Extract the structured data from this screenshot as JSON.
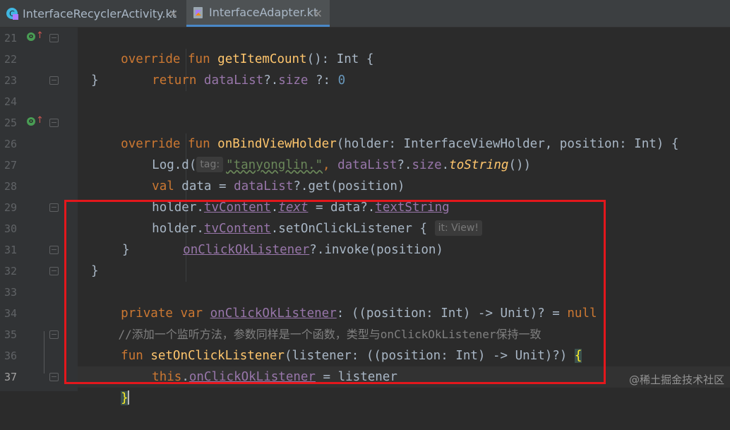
{
  "tabs": [
    {
      "label": "InterfaceRecyclerActivity.kt",
      "icon": "kotlin-class-icon",
      "active": false
    },
    {
      "label": "InterfaceAdapter.kt",
      "icon": "kotlin-file-icon",
      "active": true
    }
  ],
  "close_glyph": "✕",
  "override_marker": {
    "dot": "o",
    "arrow": "↑"
  },
  "line_numbers": [
    "21",
    "22",
    "23",
    "24",
    "25",
    "26",
    "27",
    "28",
    "29",
    "30",
    "31",
    "32",
    "33",
    "34",
    "35",
    "36",
    "37"
  ],
  "code": {
    "l21": {
      "override": "override",
      "fun": "fun",
      "name": "getItemCount",
      "rest": "(): Int {"
    },
    "l22": {
      "ret": "return",
      "dataList": "dataList",
      "qdot": "?.",
      "size": "size",
      "elvis": " ?: ",
      "zero": "0"
    },
    "l23": {
      "brace": "}"
    },
    "l25": {
      "override": "override",
      "fun": "fun",
      "name": "onBindViewHolder",
      "params": "(holder: InterfaceViewHolder, position: Int) {"
    },
    "l26": {
      "log": "Log.d(",
      "hint": "tag:",
      "str": "\"tanyonglin.\"",
      "comma": ", ",
      "dataList": "dataList",
      "qdot": "?.",
      "size": "size",
      "dot": ".",
      "toString": "toString",
      "end": "())"
    },
    "l27": {
      "val": "val",
      "mid": " data = ",
      "dataList": "dataList",
      "rest": "?.get(position)"
    },
    "l28": {
      "holder": "holder.",
      "tvContent": "tvContent",
      "dot": ".",
      "text": "text",
      "eq": " = data?.",
      "textString": "textString"
    },
    "l29": {
      "holder": "holder.",
      "tvContent": "tvContent",
      "rest": ".setOnClickListener {",
      "hint": "it: View!"
    },
    "l30": {
      "listener": "onClickOkListener",
      "rest": "?.invoke(position)"
    },
    "l31": {
      "brace": "}"
    },
    "l32": {
      "brace": "}"
    },
    "l33": {
      "private": "private",
      "var": "var",
      "name": "onClickOkListener",
      "type": ": ((position: Int) -> Unit)? = ",
      "null": "null"
    },
    "l34": {
      "comment": "//添加一个监听方法，参数同样是一个函数，类型与onClickOkListener保持一致"
    },
    "l35": {
      "fun": "fun",
      "name": "setOnClickListener",
      "params": "(listener: ((position: Int) -> Unit)?) ",
      "brace": "{"
    },
    "l36": {
      "this": "this",
      "dot": ".",
      "name": "onClickOkListener",
      "rest": " = listener"
    },
    "l37": {
      "brace": "}"
    }
  },
  "watermark": "@稀土掘金技术社区",
  "colors": {
    "background": "#2b2b2b",
    "gutter": "#313335",
    "keyword": "#cc7832",
    "function": "#ffc66d",
    "property": "#9876aa",
    "number": "#6897bb",
    "string": "#6a8759",
    "comment": "#808080",
    "highlight_box": "#e3171c"
  }
}
